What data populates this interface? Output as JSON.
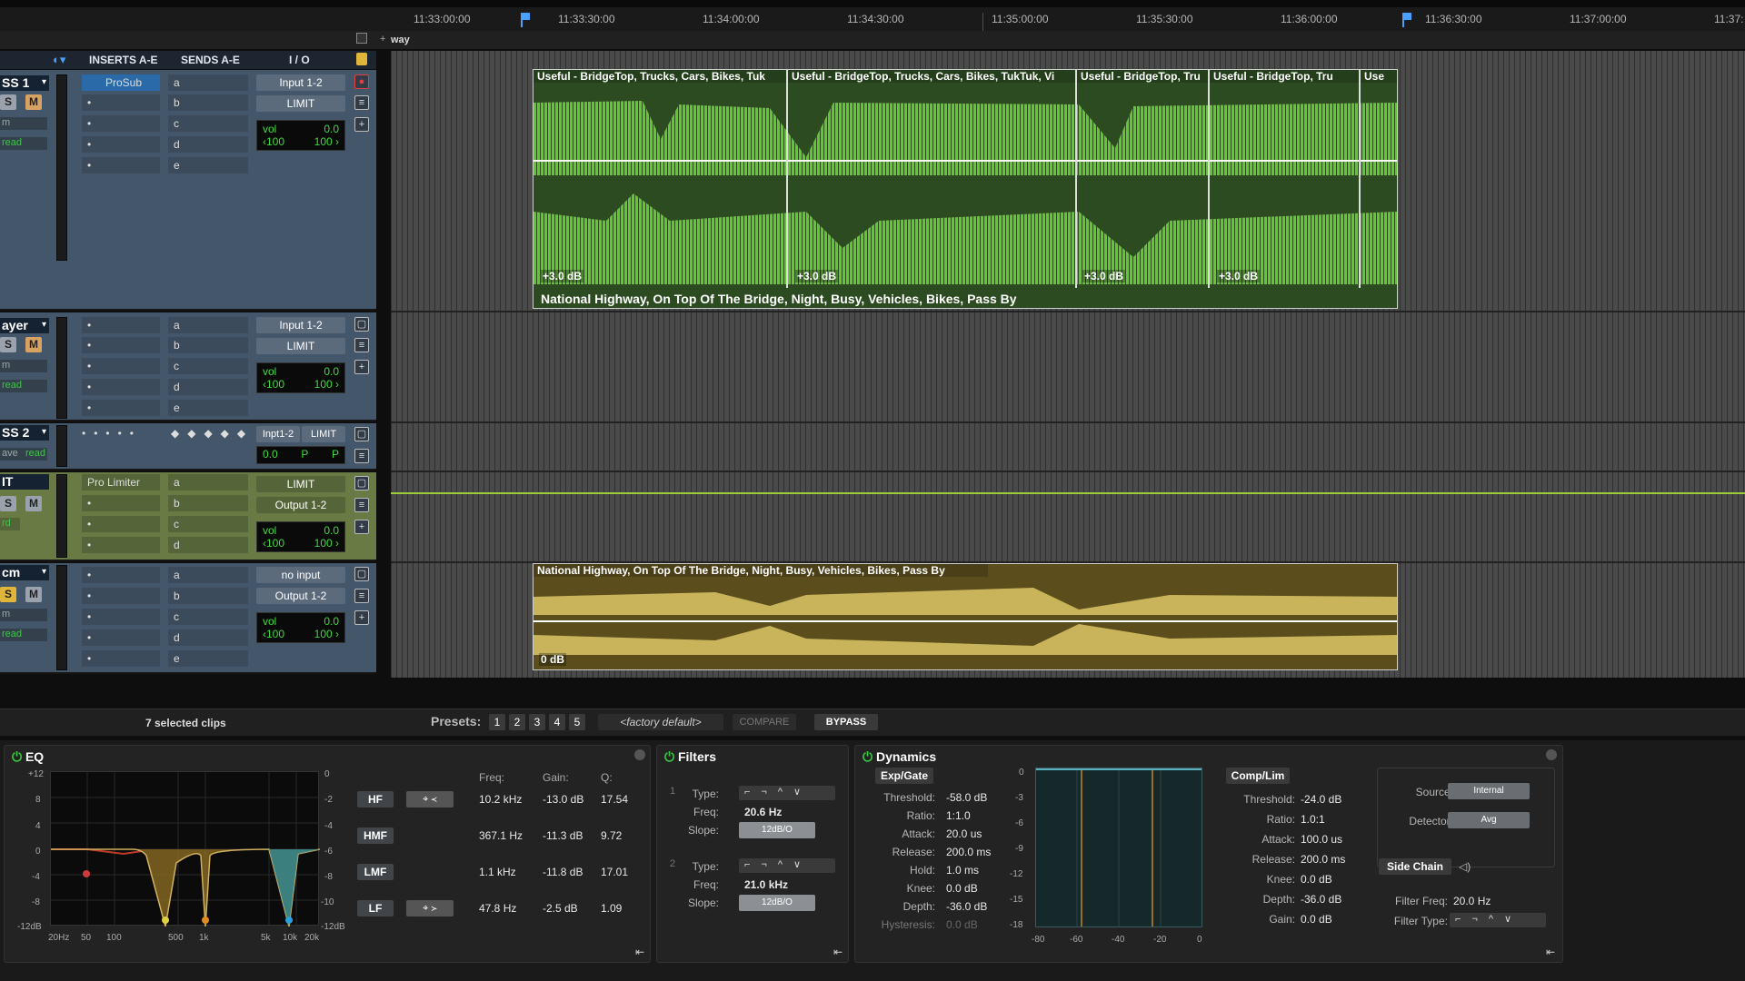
{
  "ruler": {
    "times": [
      "11:33:00:00",
      "11:33:30:00",
      "11:34:00:00",
      "11:34:30:00",
      "11:35:00:00",
      "11:35:30:00",
      "11:36:00:00",
      "11:36:30:00",
      "11:37:00:00",
      "11:37:"
    ]
  },
  "marker": {
    "name": "way"
  },
  "mix_header": {
    "inserts": "INSERTS A-E",
    "sends": "SENDS A-E",
    "io": "I / O"
  },
  "tracks": [
    {
      "name": "SS 1",
      "solo": "S",
      "mute": "M",
      "mode_a": "m",
      "automation": "read",
      "insert_a": "ProSub",
      "send_labels": [
        "a",
        "b",
        "c",
        "d",
        "e"
      ],
      "input": "Input 1-2",
      "output": "LIMIT",
      "vol_label": "vol",
      "vol_value": "0.0",
      "pan_l": "‹100",
      "pan_r": "100 ›"
    },
    {
      "name": "ayer",
      "solo": "S",
      "mute": "M",
      "mode_a": "m",
      "automation": "read",
      "send_labels": [
        "a",
        "b",
        "c",
        "d",
        "e"
      ],
      "input": "Input 1-2",
      "output": "LIMIT",
      "vol_label": "vol",
      "vol_value": "0.0",
      "pan_l": "‹100",
      "pan_r": "100 ›"
    },
    {
      "name": "SS 2",
      "mode_a": "ave",
      "automation": "read",
      "input": "Inpt1-2",
      "output": "LIMIT",
      "vol_value": "0.0",
      "pan_l": "P",
      "pan_r": "P"
    },
    {
      "name": "IT",
      "solo": "S",
      "mute": "M",
      "automation": "rd",
      "insert_a": "Pro Limiter",
      "send_labels": [
        "a",
        "b",
        "c",
        "d"
      ],
      "input": "LIMIT",
      "output": "Output 1-2",
      "vol_label": "vol",
      "vol_value": "0.0",
      "pan_l": "‹100",
      "pan_r": "100 ›"
    },
    {
      "name": "cm",
      "solo": "S",
      "mute": "M",
      "mode_a": "m",
      "automation": "read",
      "send_labels": [
        "a",
        "b",
        "c",
        "d",
        "e"
      ],
      "input": "no input",
      "output": "Output 1-2",
      "vol_label": "vol",
      "vol_value": "0.0",
      "pan_l": "‹100",
      "pan_r": "100 ›"
    }
  ],
  "clips": {
    "top": [
      {
        "label": "Useful - BridgeTop, Trucks, Cars, Bikes, Tuk",
        "gain": "+3.0 dB"
      },
      {
        "label": "Useful - BridgeTop, Trucks, Cars, Bikes, TukTuk, Vi",
        "gain": "+3.0 dB"
      },
      {
        "label": "Useful - BridgeTop, Tru",
        "gain": "+3.0 dB"
      },
      {
        "label": "Useful - BridgeTop, Tru",
        "gain": "+3.0 dB"
      },
      {
        "label": "Use",
        "gain": ""
      }
    ],
    "group_name": "National Highway, On Top Of The Bridge, Night, Busy, Vehicles, Bikes, Pass By",
    "bottom": {
      "label": "National Highway, On Top Of The Bridge, Night, Busy, Vehicles, Bikes, Pass By",
      "gain": "0 dB"
    }
  },
  "plugin_bar": {
    "selection": "7 selected clips",
    "presets_label": "Presets:",
    "presets": [
      "1",
      "2",
      "3",
      "4",
      "5"
    ],
    "preset_name": "<factory default>",
    "compare": "COMPARE",
    "bypass": "BYPASS"
  },
  "eq": {
    "title": "EQ",
    "y_left": [
      "+12",
      "8",
      "4",
      "0",
      "-4",
      "-8",
      "-12dB"
    ],
    "y_right": [
      "0",
      "-2",
      "-4",
      "-6",
      "-8",
      "-10",
      "-12dB"
    ],
    "x_labels": [
      "20Hz",
      "50",
      "100",
      "500",
      "1k",
      "5k",
      "10k",
      "20k"
    ],
    "col_freq": "Freq:",
    "col_gain": "Gain:",
    "col_q": "Q:",
    "bands": [
      {
        "name": "HF",
        "freq": "10.2 kHz",
        "gain": "-13.0 dB",
        "q": "17.54"
      },
      {
        "name": "HMF",
        "freq": "367.1 Hz",
        "gain": "-11.3 dB",
        "q": "9.72"
      },
      {
        "name": "LMF",
        "freq": "1.1 kHz",
        "gain": "-11.8 dB",
        "q": "17.01"
      },
      {
        "name": "LF",
        "freq": "47.8 Hz",
        "gain": "-2.5 dB",
        "q": "1.09"
      }
    ]
  },
  "filters": {
    "title": "Filters",
    "f1": {
      "num": "1",
      "type_label": "Type:",
      "freq_label": "Freq:",
      "freq": "20.6 Hz",
      "slope_label": "Slope:",
      "slope": "12dB/O"
    },
    "f2": {
      "num": "2",
      "type_label": "Type:",
      "freq_label": "Freq:",
      "freq": "21.0 kHz",
      "slope_label": "Slope:",
      "slope": "12dB/O"
    }
  },
  "dynamics": {
    "title": "Dynamics",
    "gate_title": "Exp/Gate",
    "gate": [
      {
        "label": "Threshold:",
        "value": "-58.0 dB"
      },
      {
        "label": "Ratio:",
        "value": "1:1.0"
      },
      {
        "label": "Attack:",
        "value": "20.0 us"
      },
      {
        "label": "Release:",
        "value": "200.0 ms"
      },
      {
        "label": "Hold:",
        "value": "1.0 ms"
      },
      {
        "label": "Knee:",
        "value": "0.0 dB"
      },
      {
        "label": "Depth:",
        "value": "-36.0 dB"
      },
      {
        "label": "Hysteresis:",
        "value": "0.0 dB"
      }
    ],
    "graph_y": [
      "0",
      "-3",
      "-6",
      "-9",
      "-12",
      "-15",
      "-18"
    ],
    "graph_x": [
      "-80",
      "-60",
      "-40",
      "-20",
      "0"
    ],
    "comp_title": "Comp/Lim",
    "comp": [
      {
        "label": "Threshold:",
        "value": "-24.0 dB"
      },
      {
        "label": "Ratio:",
        "value": "1.0:1"
      },
      {
        "label": "Attack:",
        "value": "100.0 us"
      },
      {
        "label": "Release:",
        "value": "200.0 ms"
      },
      {
        "label": "Knee:",
        "value": "0.0 dB"
      },
      {
        "label": "Depth:",
        "value": "-36.0 dB"
      },
      {
        "label": "Gain:",
        "value": "0.0 dB"
      }
    ],
    "source_label": "Source:",
    "source": "Internal",
    "detector_label": "Detector:",
    "detector": "Avg",
    "sidechain": "Side Chain",
    "filter_freq_label": "Filter Freq:",
    "filter_freq": "20.0 Hz",
    "filter_type_label": "Filter Type:"
  },
  "colors": {
    "clip_green": "#63c436",
    "clip_yellow": "#c9b45c",
    "playhead": "#c41a1a",
    "accent_green": "#39c640"
  }
}
